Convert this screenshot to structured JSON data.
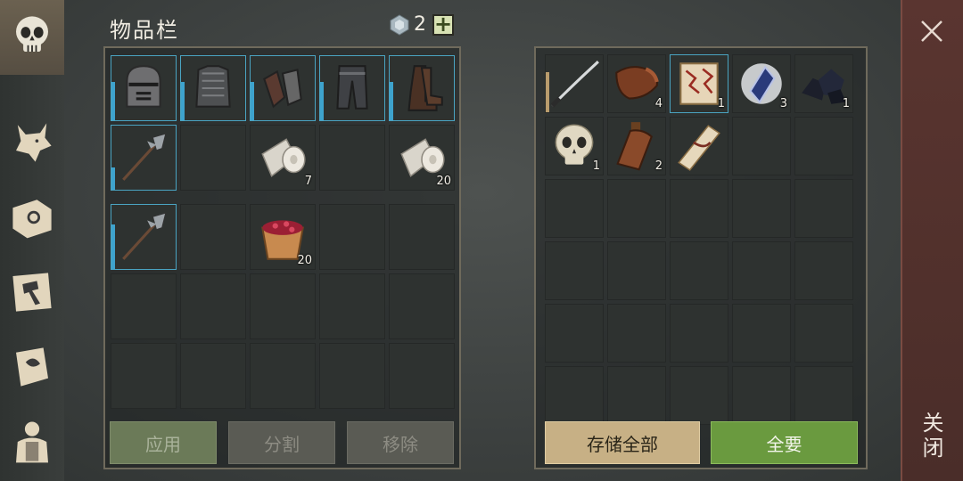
{
  "inventory": {
    "title": "物品栏",
    "premium_count": "2",
    "equipment": [
      {
        "icon": "knight-helmet-icon",
        "count": ""
      },
      {
        "icon": "chainmail-armor-icon",
        "count": ""
      },
      {
        "icon": "gauntlets-icon",
        "count": ""
      },
      {
        "icon": "armored-pants-icon",
        "count": ""
      },
      {
        "icon": "armored-boots-icon",
        "count": ""
      }
    ],
    "row2": [
      {
        "icon": "halberd-icon",
        "count": ""
      },
      {
        "icon": "",
        "count": ""
      },
      {
        "icon": "cloth-roll-icon",
        "count": "7"
      },
      {
        "icon": "",
        "count": ""
      },
      {
        "icon": "cloth-roll-icon",
        "count": "20"
      }
    ],
    "bag_row1": [
      {
        "icon": "halberd-icon",
        "count": ""
      },
      {
        "icon": "",
        "count": ""
      },
      {
        "icon": "berry-bucket-icon",
        "count": "20"
      },
      {
        "icon": "",
        "count": ""
      },
      {
        "icon": "",
        "count": ""
      }
    ],
    "buttons": {
      "apply": "应用",
      "split": "分割",
      "remove": "移除"
    }
  },
  "container": {
    "row1": [
      {
        "icon": "katana-icon",
        "count": ""
      },
      {
        "icon": "leather-icon",
        "count": "4"
      },
      {
        "icon": "rune-scroll-icon",
        "count": "1"
      },
      {
        "icon": "crystal-shard-icon",
        "count": "3"
      },
      {
        "icon": "coal-icon",
        "count": "1"
      }
    ],
    "row2": [
      {
        "icon": "skull-icon",
        "count": "1"
      },
      {
        "icon": "leather-flask-icon",
        "count": "2"
      },
      {
        "icon": "parchment-roll-icon",
        "count": ""
      },
      {
        "icon": "",
        "count": ""
      },
      {
        "icon": "",
        "count": ""
      }
    ],
    "buttons": {
      "store_all": "存储全部",
      "take_all": "全要"
    }
  },
  "close_label": "关闭",
  "colors": {
    "accent_blue": "#3ea3cd",
    "take_all_green": "#6a9a3f",
    "close_panel": "#5a3530"
  }
}
